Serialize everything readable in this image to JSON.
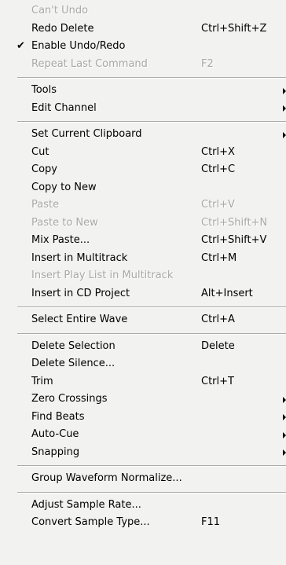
{
  "menu": {
    "g1": [
      {
        "label": "Can't Undo",
        "shortcut": "",
        "disabled": true
      },
      {
        "label": "Redo Delete",
        "shortcut": "Ctrl+Shift+Z"
      },
      {
        "label": "Enable Undo/Redo",
        "shortcut": "",
        "checked": true,
        "check_glyph": "✔"
      },
      {
        "label": "Repeat Last Command",
        "shortcut": "F2",
        "disabled": true
      }
    ],
    "g2": [
      {
        "label": "Tools",
        "submenu": true
      },
      {
        "label": "Edit Channel",
        "submenu": true
      }
    ],
    "g3": [
      {
        "label": "Set Current Clipboard",
        "submenu": true
      },
      {
        "label": "Cut",
        "shortcut": "Ctrl+X"
      },
      {
        "label": "Copy",
        "shortcut": "Ctrl+C"
      },
      {
        "label": "Copy to New",
        "shortcut": ""
      },
      {
        "label": "Paste",
        "shortcut": "Ctrl+V",
        "disabled": true
      },
      {
        "label": "Paste to New",
        "shortcut": "Ctrl+Shift+N",
        "disabled": true
      },
      {
        "label": "Mix Paste...",
        "shortcut": "Ctrl+Shift+V"
      },
      {
        "label": "Insert in Multitrack",
        "shortcut": "Ctrl+M"
      },
      {
        "label": "Insert Play List in Multitrack",
        "shortcut": "",
        "disabled": true
      },
      {
        "label": "Insert in CD Project",
        "shortcut": "Alt+Insert"
      }
    ],
    "g4": [
      {
        "label": "Select Entire Wave",
        "shortcut": "Ctrl+A"
      }
    ],
    "g5": [
      {
        "label": "Delete Selection",
        "shortcut": "Delete"
      },
      {
        "label": "Delete Silence...",
        "shortcut": ""
      },
      {
        "label": "Trim",
        "shortcut": "Ctrl+T"
      },
      {
        "label": "Zero Crossings",
        "submenu": true
      },
      {
        "label": "Find Beats",
        "submenu": true
      },
      {
        "label": "Auto-Cue",
        "submenu": true
      },
      {
        "label": "Snapping",
        "submenu": true
      }
    ],
    "g6": [
      {
        "label": "Group Waveform Normalize...",
        "shortcut": ""
      }
    ],
    "g7": [
      {
        "label": "Adjust Sample Rate...",
        "shortcut": ""
      },
      {
        "label": "Convert Sample Type...",
        "shortcut": "F11"
      }
    ]
  }
}
